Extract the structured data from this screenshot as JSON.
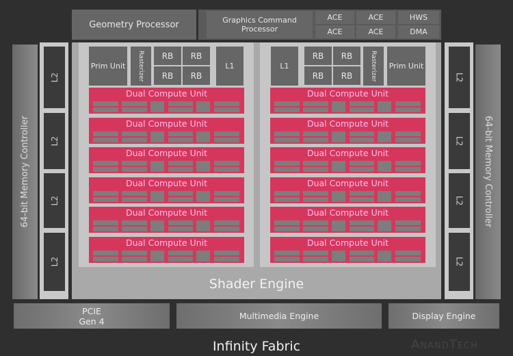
{
  "geometry_processor": "Geometry Processor",
  "command": {
    "gcp": "Graphics Command Processor",
    "ace": [
      "ACE",
      "ACE",
      "ACE",
      "ACE"
    ],
    "hws": "HWS",
    "dma": "DMA"
  },
  "memory_controller": "64-bit Memory Controller",
  "l2": "L2",
  "shader_engine": "Shader Engine",
  "prim_unit": "Prim Unit",
  "rasterizer": "Rasterizer",
  "rb": "RB",
  "l1": "L1",
  "dcu": "Dual Compute Unit",
  "dcu_count_per_side": 6,
  "pcie": [
    "PCIE",
    "Gen 4"
  ],
  "multimedia": "Multimedia Engine",
  "display": "Display Engine",
  "fabric": "Infinity Fabric",
  "watermark": "AnandTech",
  "colors": {
    "dcu": "#d5375c",
    "background": "#2f2f2f"
  }
}
